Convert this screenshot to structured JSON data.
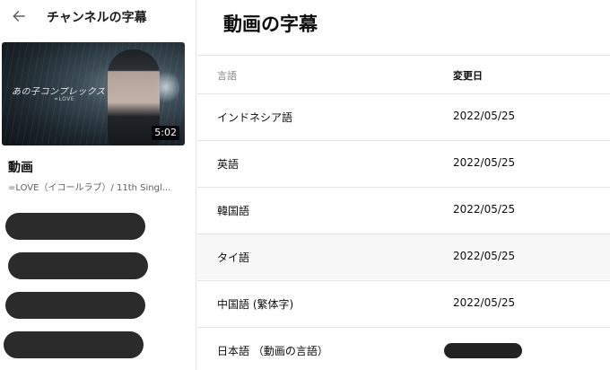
{
  "sidebar": {
    "title": "チャンネルの字幕",
    "back_icon": "arrow-left-icon",
    "video": {
      "section_label": "動画",
      "title": "=LOVE（イコールラブ）/ 11th Singl...",
      "duration": "5:02",
      "thumbnail_text": "あの子コンプレックス",
      "thumbnail_subtext": "=LOVE"
    },
    "nav_items_redacted": 4
  },
  "main": {
    "title": "動画の字幕",
    "columns": {
      "language": "言語",
      "modified": "変更日"
    },
    "rows": [
      {
        "language": "インドネシア語",
        "modified": "2022/05/25"
      },
      {
        "language": "英語",
        "modified": "2022/05/25"
      },
      {
        "language": "韓国語",
        "modified": "2022/05/25"
      },
      {
        "language": "タイ語",
        "modified": "2022/05/25"
      },
      {
        "language": "中国語 (繁体字)",
        "modified": "2022/05/25"
      },
      {
        "language": "日本語 （動画の言語）",
        "modified": ""
      }
    ]
  },
  "colors": {
    "redaction": "#2b2b2b",
    "row_highlight": "#f7f7f7",
    "divider": "#e3e3e3"
  }
}
